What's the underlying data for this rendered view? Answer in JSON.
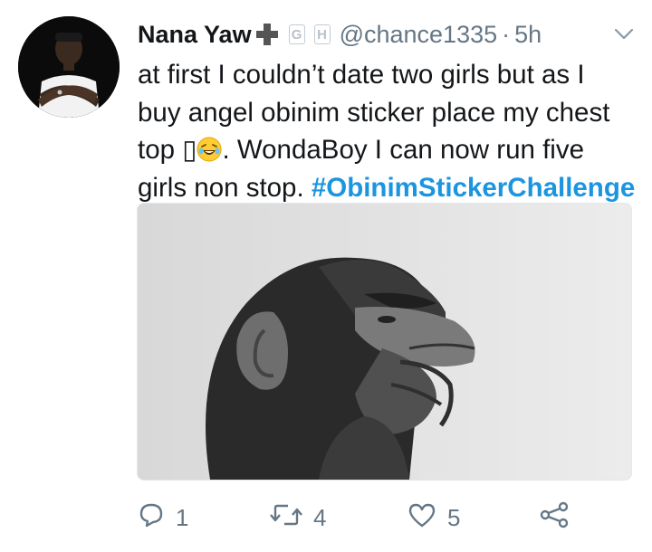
{
  "tweet": {
    "author_name": "Nana Yaw",
    "badge_1": "G",
    "badge_2": "H",
    "handle": "@chance1335",
    "separator": "·",
    "time": "5h",
    "text_lines": [
      "at first I couldn’t date two girls but as I",
      "buy angel obinim sticker place my chest",
      "top ▯",
      ". WondaBoy I can now run five",
      "girls non stop."
    ],
    "hashtag": "#ObinimStickerChallenge",
    "media_description_icon": "chimpanzee-thinking-photo",
    "colors": {
      "hashtag": "#1b95e0",
      "secondary": "#657786",
      "text": "#14171a"
    }
  },
  "actions": {
    "reply_icon": "reply-icon",
    "reply_count": "1",
    "retweet_icon": "retweet-icon",
    "retweet_count": "4",
    "like_icon": "heart-icon",
    "like_count": "5",
    "share_icon": "share-icon"
  }
}
